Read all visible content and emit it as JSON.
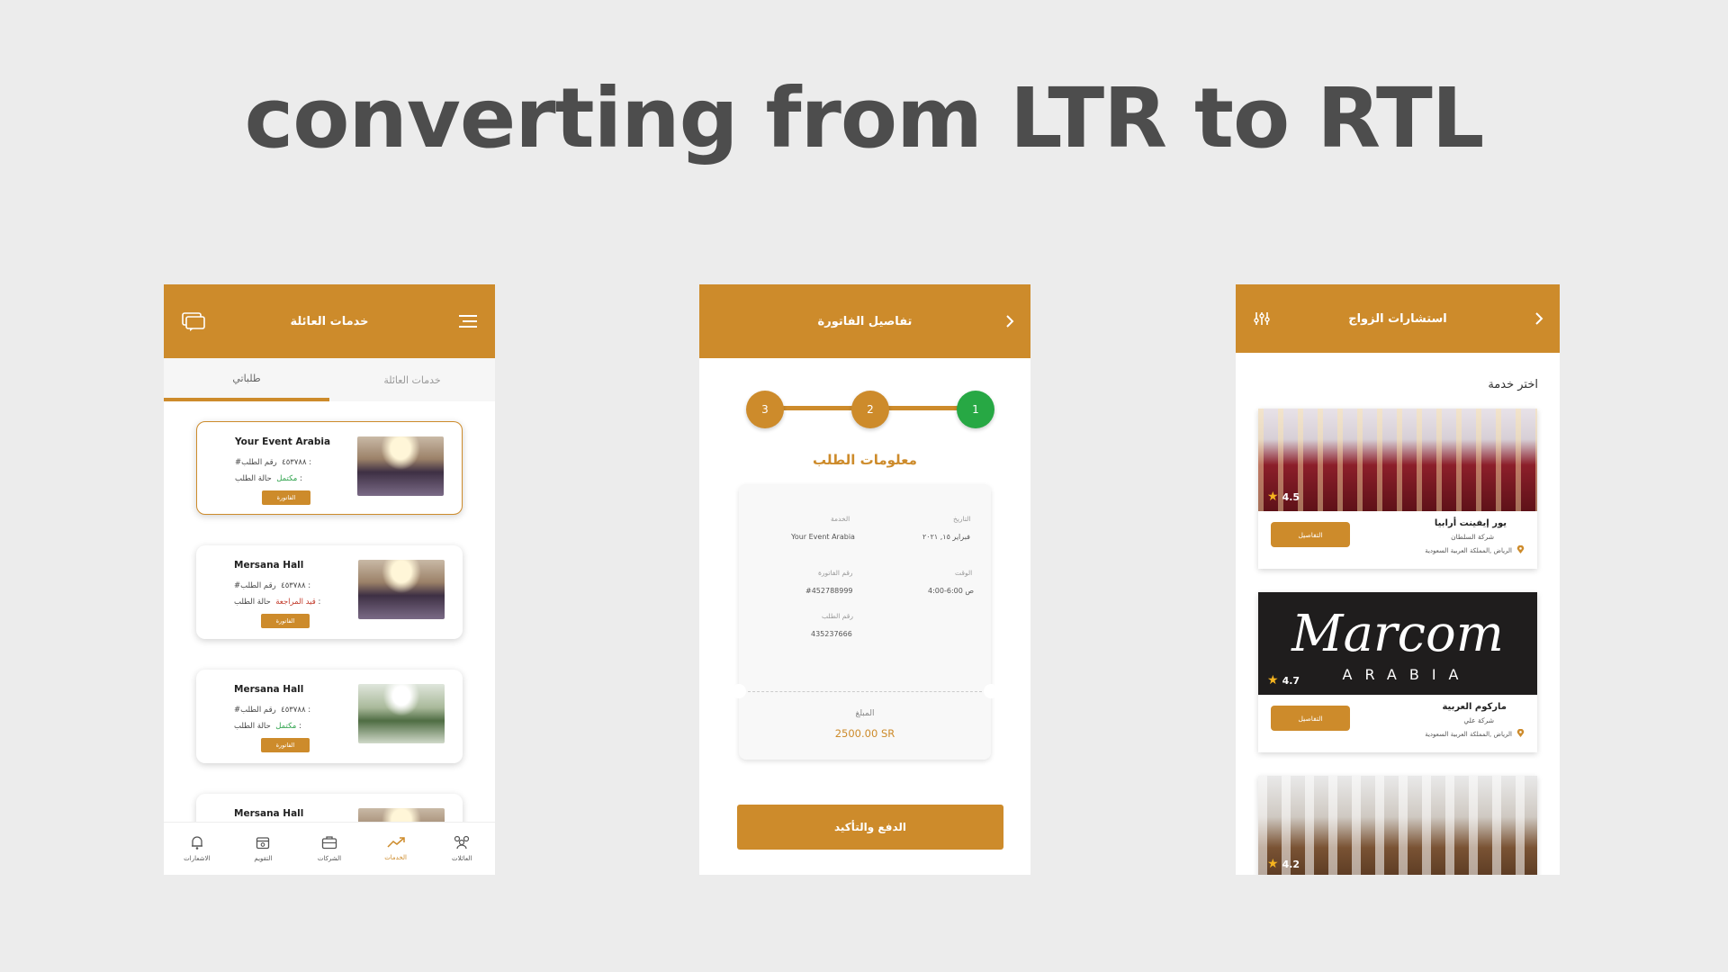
{
  "page": {
    "heading": "converting from LTR to RTL"
  },
  "colors": {
    "primary": "#cd8b2b",
    "success": "#27a844",
    "danger": "#c23a2a",
    "background": "#ececec"
  },
  "screen1": {
    "title": "خدمات العائلة",
    "left_icon": "chat-icon",
    "right_icon": "menu-icon",
    "tabs": [
      {
        "label": "طلباتي",
        "active": true
      },
      {
        "label": "خدمات العائلة",
        "active": false
      }
    ],
    "cards": [
      {
        "name": "Your Event Arabia",
        "order_label": "رقم الطلب :",
        "order_no": "#٤٥٣٧٨٨",
        "status_label": "حالة الطلب :",
        "status": "مكتمل",
        "button": "الفاتورة"
      },
      {
        "name": "Mersana Hall",
        "order_label": "رقم الطلب :",
        "order_no": "#٤٥٣٧٨٨",
        "status_label": "حالة الطلب :",
        "status": "قيد المراجعة",
        "button": "الفاتورة"
      },
      {
        "name": "Mersana Hall",
        "order_label": "رقم الطلب :",
        "order_no": "#٤٥٣٧٨٨",
        "status_label": "حالة الطلب :",
        "status": "مكتمل",
        "button": "الفاتورة"
      },
      {
        "name": "Mersana Hall"
      }
    ],
    "nav": [
      {
        "label": "الاشعارات",
        "icon": "bell-icon"
      },
      {
        "label": "التقويم",
        "icon": "calendar-icon"
      },
      {
        "label": "الشركات",
        "icon": "briefcase-icon"
      },
      {
        "label": "الخدمات",
        "icon": "trending-icon",
        "active": true
      },
      {
        "label": "العائلات",
        "icon": "people-icon"
      }
    ]
  },
  "screen2": {
    "title": "تفاصيل الفاتورة",
    "back_icon": "chevron-right-icon",
    "steps": [
      "3",
      "2",
      "1"
    ],
    "step_title": "معلومات الطلب",
    "fields": {
      "service_label": "الخدمة",
      "service": "Your Event Arabia",
      "date_label": "التاريخ",
      "date": "فبراير ١٥, ٢٠٢١",
      "invoice_label": "رقم الفاتورة",
      "invoice": "#452788999",
      "time_label": "الوقت",
      "time": "4:00-6:00 ص",
      "order_label": "رقم الطلب",
      "order": "435237666"
    },
    "amount_label": "المبلغ",
    "amount": "2500.00 SR",
    "pay_button": "الدفع والتأكيد"
  },
  "screen3": {
    "title": "استشارات الزواج",
    "left_icon": "filter-icon",
    "right_icon": "chevron-right-icon",
    "section": "اختر خدمة",
    "services": [
      {
        "rating": "4.5",
        "name": "يور إيفينت أرابيا",
        "company": "شركة السلطان",
        "location": "الرياض ,المملكة العربية السعودية",
        "button": "التفاصيل"
      },
      {
        "rating": "4.7",
        "name": "ماركوم العربية",
        "company": "شركة علي",
        "location": "الرياض ,المملكة العربية السعودية",
        "button": "التفاصيل",
        "logo_text": "Marcom",
        "logo_sub": "ARABIA"
      },
      {
        "rating": "4.2"
      }
    ]
  }
}
